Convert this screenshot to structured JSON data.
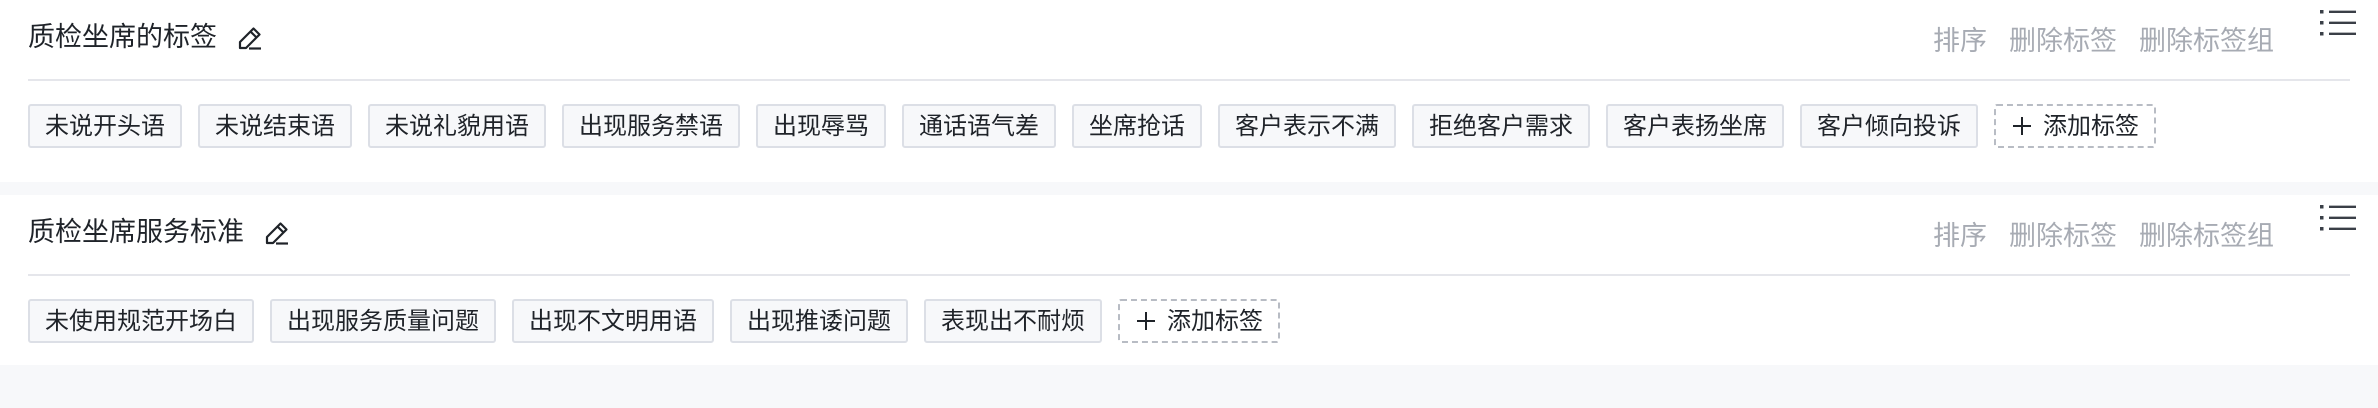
{
  "groups": [
    {
      "title": "质检坐席的标签",
      "actions": {
        "sort": "排序",
        "delete_tag": "删除标签",
        "delete_group": "删除标签组"
      },
      "tags": [
        "未说开头语",
        "未说结束语",
        "未说礼貌用语",
        "出现服务禁语",
        "出现辱骂",
        "通话语气差",
        "坐席抢话",
        "客户表示不满",
        "拒绝客户需求",
        "客户表扬坐席",
        "客户倾向投诉"
      ],
      "add_label": "添加标签"
    },
    {
      "title": "质检坐席服务标准",
      "actions": {
        "sort": "排序",
        "delete_tag": "删除标签",
        "delete_group": "删除标签组"
      },
      "tags": [
        "未使用规范开场白",
        "出现服务质量问题",
        "出现不文明用语",
        "出现推诿问题",
        "表现出不耐烦"
      ],
      "add_label": "添加标签"
    }
  ],
  "icons": {
    "edit": "pencil-icon",
    "menu": "list-icon",
    "add": "plus-icon"
  },
  "colors": {
    "title": "#1f2329",
    "action": "#a7abb3",
    "tag_border": "#dcdfe6",
    "tag_bg": "#f7f8fa",
    "page_bg": "#f7f8fa"
  }
}
